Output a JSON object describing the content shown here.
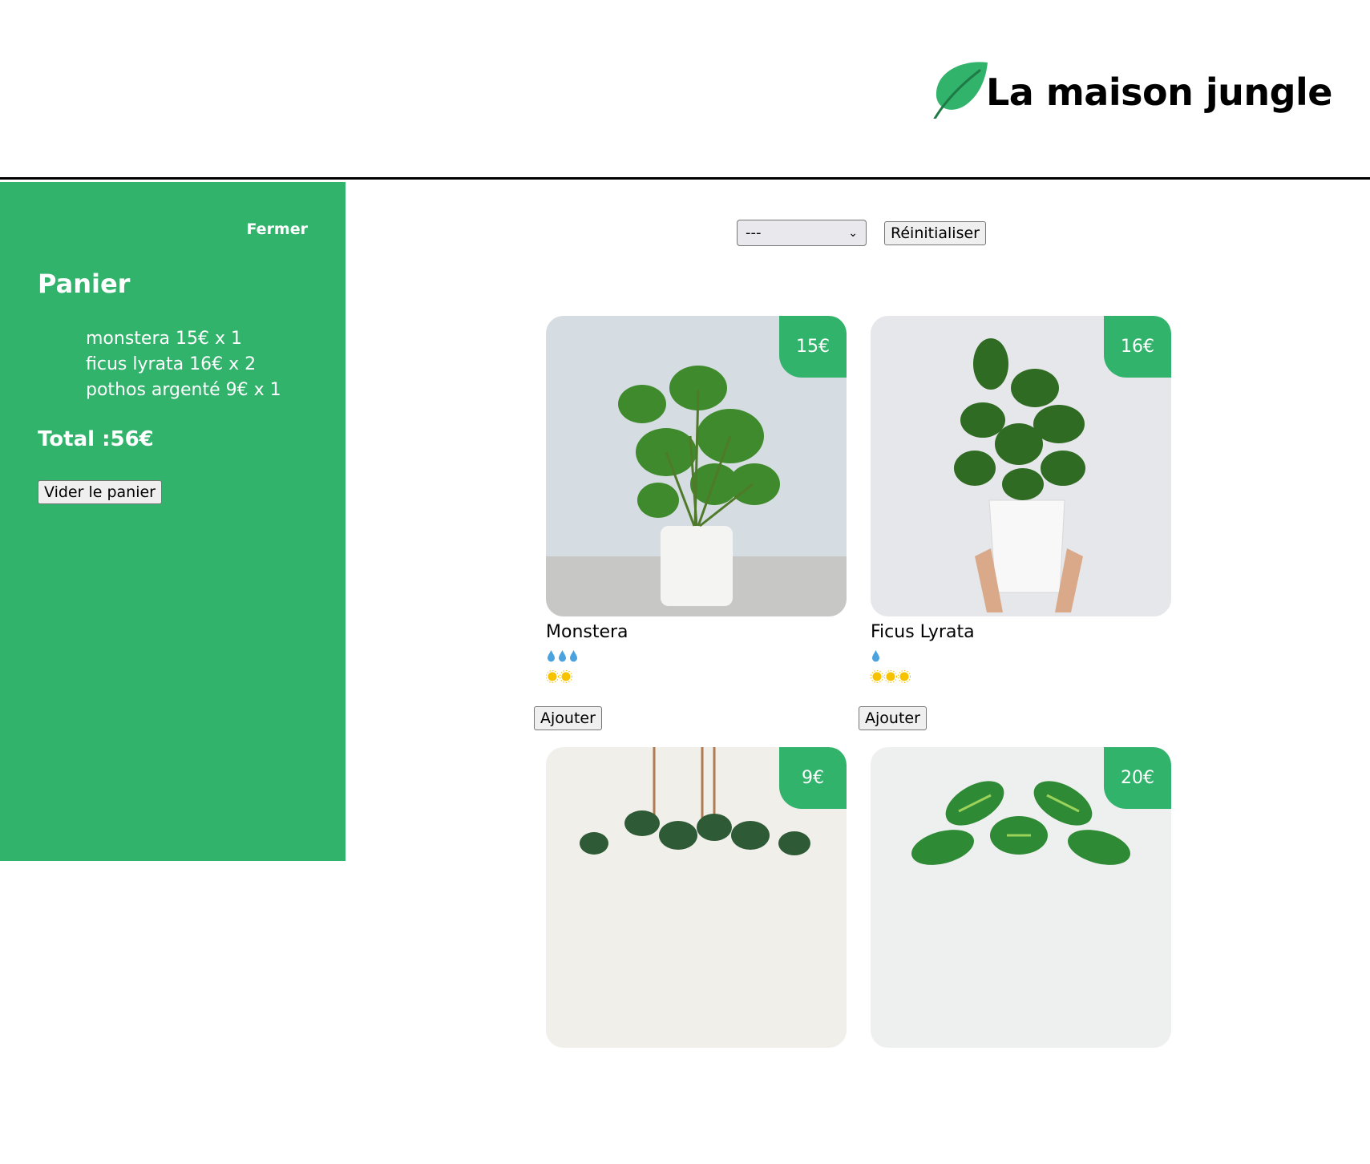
{
  "banner": {
    "title": "La maison jungle",
    "logo_icon": "leaf-icon"
  },
  "cart": {
    "close_label": "Fermer",
    "title": "Panier",
    "items": [
      {
        "text": "monstera 15€ x 1"
      },
      {
        "text": "ficus lyrata 16€ x 2"
      },
      {
        "text": "pothos argenté 9€ x 1"
      }
    ],
    "total": "Total :56€",
    "empty_label": "Vider le panier"
  },
  "filter": {
    "selected": "---",
    "reset_label": "Réinitialiser"
  },
  "plants": [
    {
      "name": "Monstera",
      "price": "15€",
      "water": 3,
      "light": 2,
      "add_label": "Ajouter"
    },
    {
      "name": "Ficus Lyrata",
      "price": "16€",
      "water": 1,
      "light": 3,
      "add_label": "Ajouter"
    },
    {
      "name": "",
      "price": "9€",
      "add_label": ""
    },
    {
      "name": "",
      "price": "20€",
      "add_label": ""
    }
  ],
  "colors": {
    "brand_green": "#31b36c",
    "water_blue": "#4aa3df",
    "sun_yellow": "#f7c300"
  }
}
